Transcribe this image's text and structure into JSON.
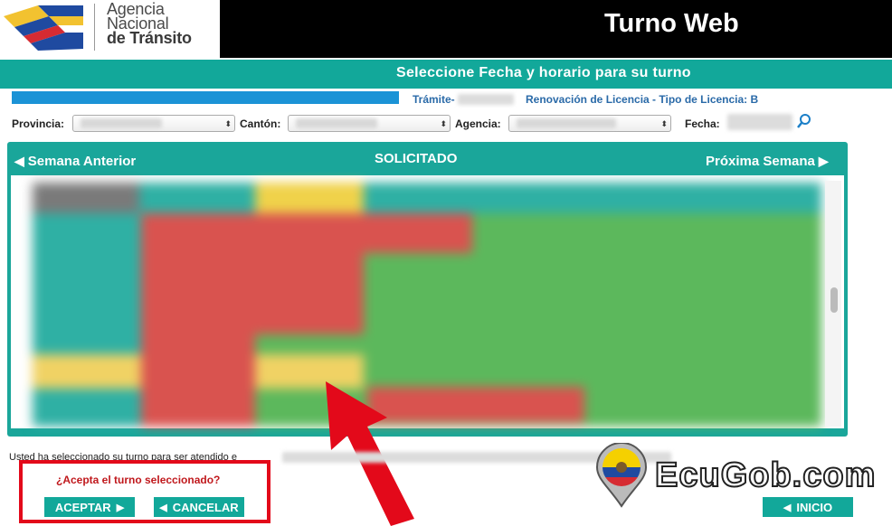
{
  "header": {
    "brand_lines": [
      "Agencia",
      "Nacional",
      "de Tránsito"
    ],
    "app_title": "Turno Web"
  },
  "step_title": "Seleccione Fecha y horario para su turno",
  "tramite": {
    "label": "Trámite-",
    "description": "Renovación de Licencia - Tipo de Licencia: B"
  },
  "filters": {
    "provincia_label": "Provincia:",
    "canton_label": "Cantón:",
    "agencia_label": "Agencia:",
    "fecha_label": "Fecha:"
  },
  "calendar": {
    "prev_label": "Semana Anterior",
    "status_label": "SOLICITADO",
    "next_label": "Próxima Semana"
  },
  "selection_text": "Usted ha seleccionado su turno para ser atendido e",
  "confirm": {
    "question": "¿Acepta el turno seleccionado?",
    "accept_label": "ACEPTAR",
    "cancel_label": "CANCELAR"
  },
  "inicio_label": "INICIO",
  "watermark_text": "EcuGob.com",
  "colors": {
    "teal": "#12a89a",
    "red_highlight": "#e3091a",
    "slot_available": "#5cb85c",
    "slot_taken": "#d9534f",
    "slot_pending": "#f0d264"
  }
}
